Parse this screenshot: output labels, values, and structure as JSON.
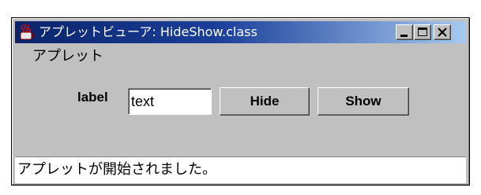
{
  "window": {
    "title": "アプレットビューア: HideShow.class",
    "icon": "duke-coffee-icon"
  },
  "menu": {
    "items": [
      {
        "label": "アプレット"
      }
    ]
  },
  "applet": {
    "label_text": "label",
    "text_field": {
      "value": "text"
    },
    "hide_button": "Hide",
    "show_button": "Show"
  },
  "status": {
    "text": "アプレットが開始されました。"
  },
  "colors": {
    "titlebar_start": "#0a246a",
    "titlebar_end": "#a6caf0",
    "face": "#c0c0c0"
  }
}
